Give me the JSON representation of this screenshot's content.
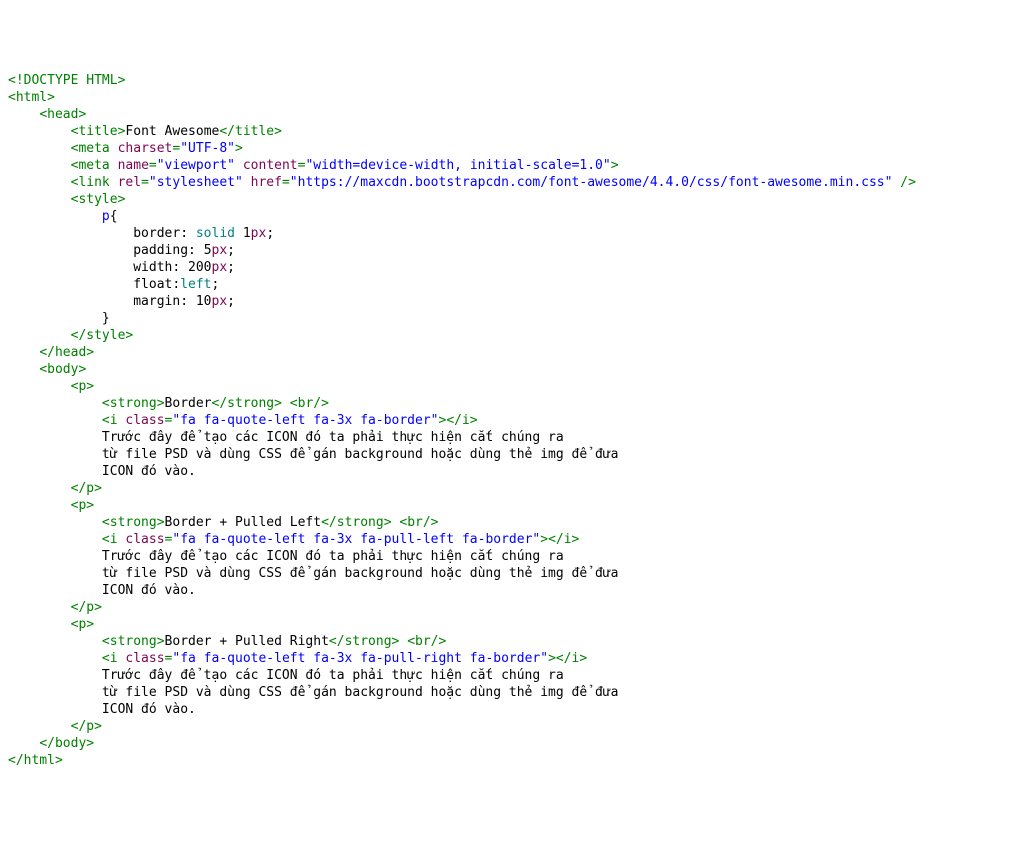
{
  "lines": {
    "l01_doctype": "<!DOCTYPE HTML>",
    "l02_html_open": "<html>",
    "l03_head_open": "<head>",
    "l04_title_open": "<title>",
    "l04_title_text": "Font Awesome",
    "l04_title_close": "</title>",
    "l05_meta": "<meta",
    "l05_charset_attr": "charset",
    "l05_charset_val": "\"UTF-8\"",
    "l05_meta_close": ">",
    "l06_meta": "<meta",
    "l06_name_attr": "name",
    "l06_name_val": "\"viewport\"",
    "l06_content_attr": "content",
    "l06_content_val": "\"width=device-width, initial-scale=1.0\"",
    "l06_close": ">",
    "l07_link": "<link",
    "l07_rel_attr": "rel",
    "l07_rel_val": "\"stylesheet\"",
    "l07_href_attr": "href",
    "l07_href_val": "\"https://maxcdn.bootstrapcdn.com/font-awesome/4.4.0/css/font-awesome.min.css\"",
    "l07_close": " />",
    "l08_style_open": "<style>",
    "l09_sel": "p",
    "l09_brace": "{",
    "l10_prop": "border",
    "l10_kw": "solid",
    "l10_num": "1",
    "l10_unit": "px",
    "l11_prop": "padding",
    "l11_num": "5",
    "l11_unit": "px",
    "l12_prop": "width",
    "l12_num": "200",
    "l12_unit": "px",
    "l13_prop": "float",
    "l13_kw": "left",
    "l14_prop": "margin",
    "l14_num": "10",
    "l14_unit": "px",
    "l15_brace": "}",
    "l16_style_close": "</style>",
    "l17_head_close": "</head>",
    "l18_body_open": "<body>",
    "p1_open": "<p>",
    "p1_strong_open": "<strong>",
    "p1_strong_text": "Border",
    "p1_strong_close": "</strong>",
    "p1_br": "<br/>",
    "p1_i_open": "<i",
    "p1_class_attr": "class",
    "p1_class_val": "\"fa fa-quote-left fa-3x fa-border\"",
    "p1_i_mid": ">",
    "p1_i_close": "</i>",
    "p1_text1": "Trước đây để tạo các ICON đó ta phải thực hiện cắt chúng ra",
    "p1_text2": "từ file PSD và dùng CSS để gán background hoặc dùng thẻ img để đưa",
    "p1_text3": "ICON đó vào.",
    "p1_close": "</p>",
    "p2_open": "<p>",
    "p2_strong_open": "<strong>",
    "p2_strong_text": "Border + Pulled Left",
    "p2_strong_close": "</strong>",
    "p2_br": "<br/>",
    "p2_i_open": "<i",
    "p2_class_attr": "class",
    "p2_class_val": "\"fa fa-quote-left fa-3x fa-pull-left fa-border\"",
    "p2_i_mid": ">",
    "p2_i_close": "</i>",
    "p2_text1": "Trước đây để tạo các ICON đó ta phải thực hiện cắt chúng ra",
    "p2_text2": "từ file PSD và dùng CSS để gán background hoặc dùng thẻ img để đưa",
    "p2_text3": "ICON đó vào.",
    "p2_close": "</p>",
    "p3_open": "<p>",
    "p3_strong_open": "<strong>",
    "p3_strong_text": "Border + Pulled Right",
    "p3_strong_close": "</strong>",
    "p3_br": "<br/>",
    "p3_i_open": "<i",
    "p3_class_attr": "class",
    "p3_class_val": "\"fa fa-quote-left fa-3x fa-pull-right fa-border\"",
    "p3_i_mid": ">",
    "p3_i_close": "</i>",
    "p3_text1": "Trước đây để tạo các ICON đó ta phải thực hiện cắt chúng ra",
    "p3_text2": "từ file PSD và dùng CSS để gán background hoặc dùng thẻ img để đưa",
    "p3_text3": "ICON đó vào.",
    "p3_close": "</p>",
    "body_close": "</body>",
    "html_close": "</html>"
  }
}
